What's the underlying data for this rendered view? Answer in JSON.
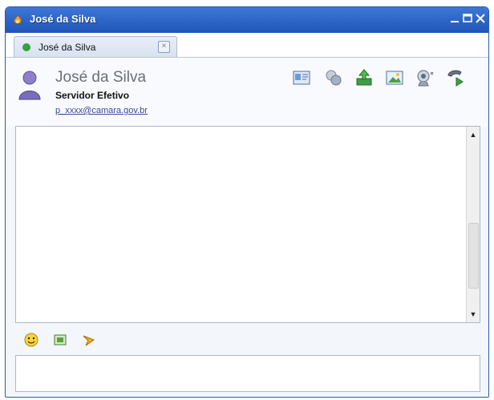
{
  "window": {
    "title": "José da Silva"
  },
  "tab": {
    "label": "José da Silva"
  },
  "contact": {
    "name": "José da Silva",
    "status": "Servidor Efetivo",
    "email": "p_xxxx@camara.gov.br"
  },
  "toolbar": {
    "icons": [
      "contact-card-icon",
      "attachment-icon",
      "send-file-icon",
      "image-icon",
      "video-call-icon",
      "phone-call-icon"
    ]
  },
  "input_toolbar": {
    "icons": [
      "emoticon-icon",
      "screenshot-icon",
      "nudge-icon"
    ]
  },
  "chat": {
    "messages": []
  },
  "input": {
    "value": ""
  }
}
